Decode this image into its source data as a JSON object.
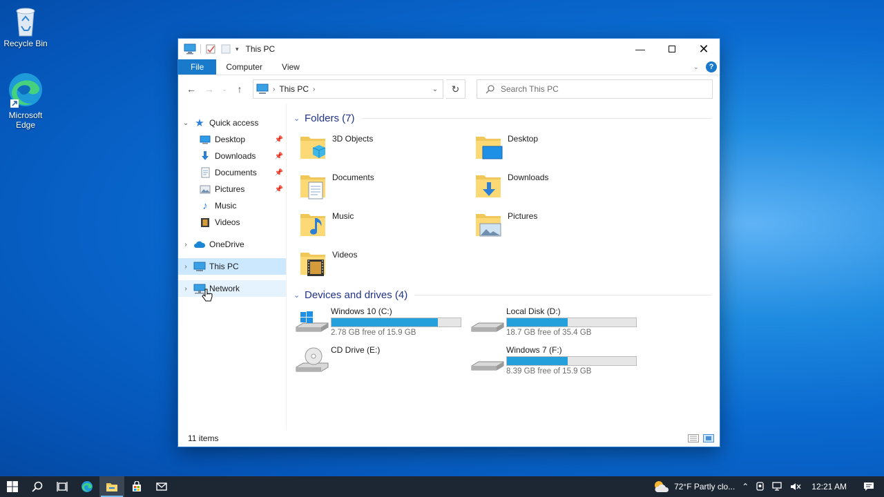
{
  "desktop": {
    "icons": [
      {
        "label": "Recycle Bin"
      },
      {
        "label": "Microsoft Edge"
      }
    ]
  },
  "window": {
    "title": "This PC",
    "ribbon_tabs": [
      "File",
      "Computer",
      "View"
    ],
    "address": {
      "crumb": "This PC"
    },
    "search": {
      "placeholder": "Search This PC"
    }
  },
  "navpane": {
    "quick_access": "Quick access",
    "quick_items": [
      {
        "label": "Desktop",
        "icon": "desktop-icon",
        "pinned": true
      },
      {
        "label": "Downloads",
        "icon": "downloads-icon",
        "pinned": true
      },
      {
        "label": "Documents",
        "icon": "documents-icon",
        "pinned": true
      },
      {
        "label": "Pictures",
        "icon": "pictures-icon",
        "pinned": true
      },
      {
        "label": "Music",
        "icon": "music-icon",
        "pinned": false
      },
      {
        "label": "Videos",
        "icon": "videos-icon",
        "pinned": false
      }
    ],
    "onedrive": "OneDrive",
    "thispc": "This PC",
    "network": "Network"
  },
  "content": {
    "folders_header": "Folders (7)",
    "folders": [
      "3D Objects",
      "Desktop",
      "Documents",
      "Downloads",
      "Music",
      "Pictures",
      "Videos"
    ],
    "drives_header": "Devices and drives (4)",
    "drives": [
      {
        "name": "Windows 10 (C:)",
        "free": "2.78 GB free of 15.9 GB",
        "used_fraction": 0.825
      },
      {
        "name": "Local Disk (D:)",
        "free": "18.7 GB free of 35.4 GB",
        "used_fraction": 0.47
      },
      {
        "name": "CD Drive (E:)",
        "free": "",
        "used_fraction": null
      },
      {
        "name": "Windows 7 (F:)",
        "free": "8.39 GB free of 15.9 GB",
        "used_fraction": 0.47
      }
    ]
  },
  "statusbar": {
    "items": "11 items"
  },
  "taskbar": {
    "weather": "72°F Partly clo...",
    "time": "12:21 AM"
  },
  "colors": {
    "accent": "#1979ca",
    "bar_fill": "#26a0da",
    "header_text": "#1e3287",
    "selection": "#cce8ff"
  }
}
